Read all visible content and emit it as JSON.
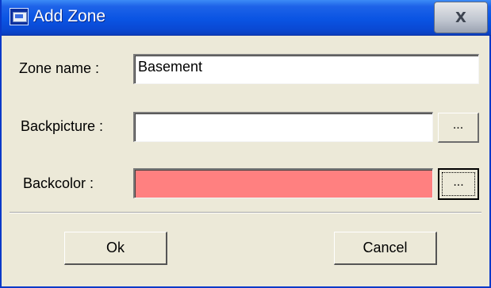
{
  "window": {
    "title": "Add Zone",
    "close_glyph": "X"
  },
  "form": {
    "zone_name": {
      "label": "Zone name :",
      "value": "Basement"
    },
    "backpicture": {
      "label": "Backpicture :",
      "value": "",
      "browse_label": "..."
    },
    "backcolor": {
      "label": "Backcolor :",
      "color": "#ff8080",
      "browse_label": "..."
    }
  },
  "buttons": {
    "ok_label": "Ok",
    "cancel_label": "Cancel"
  }
}
